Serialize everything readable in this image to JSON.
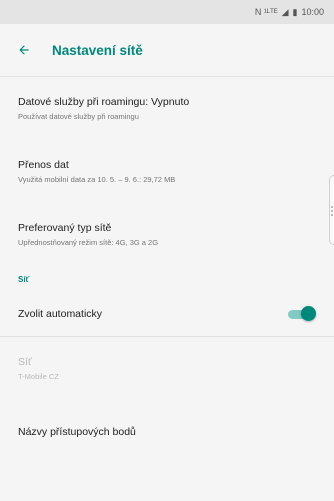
{
  "status_bar": {
    "icons_text": "N ¹ᴸᵀᴱ",
    "signal_icon": "◢",
    "battery_icon": "▮",
    "time": "10:00"
  },
  "header": {
    "title": "Nastavení sítě",
    "back_icon": "arrow-left-icon"
  },
  "items": [
    {
      "title": "Datové služby při roamingu: Vypnuto",
      "summary": "Používat datové služby při roamingu"
    },
    {
      "title": "Přenos dat",
      "summary": "Využitá mobilní data za 10. 5. – 9. 6.: 29,72 MB"
    },
    {
      "title": "Preferovaný typ sítě",
      "summary": "Upřednostňovaný režim sítě: 4G, 3G a 2G"
    }
  ],
  "network_section": {
    "category_label": "Síť",
    "auto_select": {
      "title": "Zvolit automaticky",
      "enabled": true
    },
    "network": {
      "title": "Síť",
      "summary": "T-Mobile CZ"
    },
    "apn": {
      "title": "Názvy přístupových bodů"
    }
  },
  "colors": {
    "accent": "#00897b",
    "switch_track": "#80cbc4",
    "background": "#f5f5f5",
    "status_bar": "#e4e4e4"
  }
}
